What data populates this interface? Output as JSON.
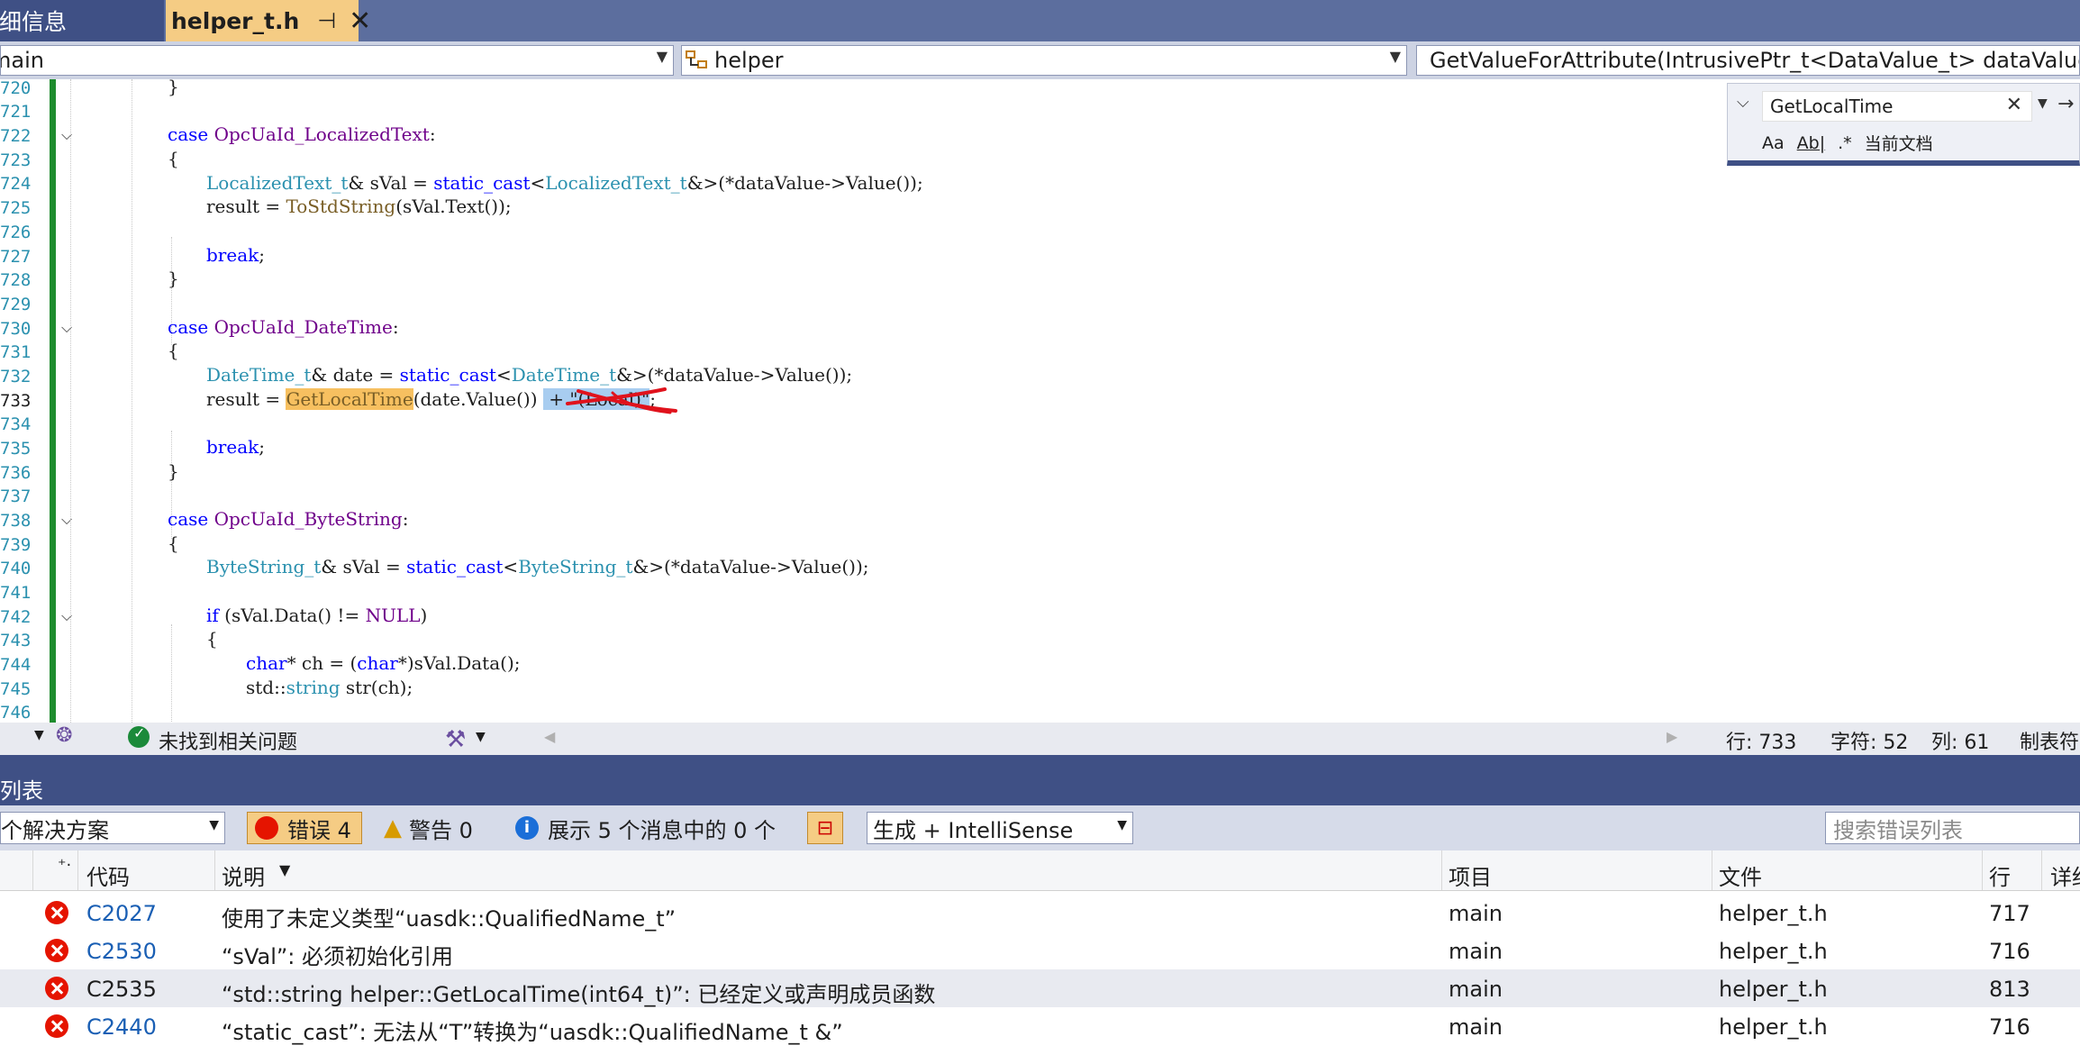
{
  "tabs": {
    "inactive_label": "详细信息",
    "active_label": "helper_t.h",
    "pin_glyph": "⊣",
    "close_glyph": "✕"
  },
  "nav": {
    "scope": "main",
    "class": "helper",
    "member": "GetValueForAttribute(IntrusivePtr_t<DataValue_t> dataValue"
  },
  "find": {
    "query": "GetLocalTime",
    "match_case": "Aa",
    "whole_word": "Ab|",
    "regex": ".*",
    "scope": "当前文档"
  },
  "editor": {
    "line_numbers": [
      "720",
      "721",
      "722",
      "723",
      "724",
      "725",
      "726",
      "727",
      "728",
      "729",
      "730",
      "731",
      "732",
      "733",
      "734",
      "735",
      "736",
      "737",
      "738",
      "739",
      "740",
      "741",
      "742",
      "743",
      "744",
      "745",
      "746"
    ],
    "annotation_color": "#e0121c"
  },
  "status": {
    "issues": "未找到相关问题",
    "line": "行: 733",
    "char": "字符: 52",
    "col": "列: 61",
    "tabs": "制表符"
  },
  "error_list": {
    "title": "错误列表",
    "scope": "整个解决方案",
    "errors_label": "错误 4",
    "warnings_label": "警告 0",
    "messages_label": "展示 5 个消息中的 0 个",
    "build_filter": "生成 + IntelliSense",
    "search_placeholder": "搜索错误列表",
    "columns": {
      "code": "代码",
      "description": "说明",
      "project": "项目",
      "file": "文件",
      "line": "行",
      "detail": "详细"
    },
    "rows": [
      {
        "code": "C2027",
        "description": "使用了未定义类型“uasdk::QualifiedName_t”",
        "project": "main",
        "file": "helper_t.h",
        "line": "717"
      },
      {
        "code": "C2530",
        "description": "“sVal”: 必须初始化引用",
        "project": "main",
        "file": "helper_t.h",
        "line": "716"
      },
      {
        "code": "C2535",
        "description": "“std::string helper::GetLocalTime(int64_t)”: 已经定义或声明成员函数",
        "project": "main",
        "file": "helper_t.h",
        "line": "813"
      },
      {
        "code": "C2440",
        "description": "“static_cast”: 无法从“T”转换为“uasdk::QualifiedName_t &”",
        "project": "main",
        "file": "helper_t.h",
        "line": "716"
      }
    ]
  }
}
